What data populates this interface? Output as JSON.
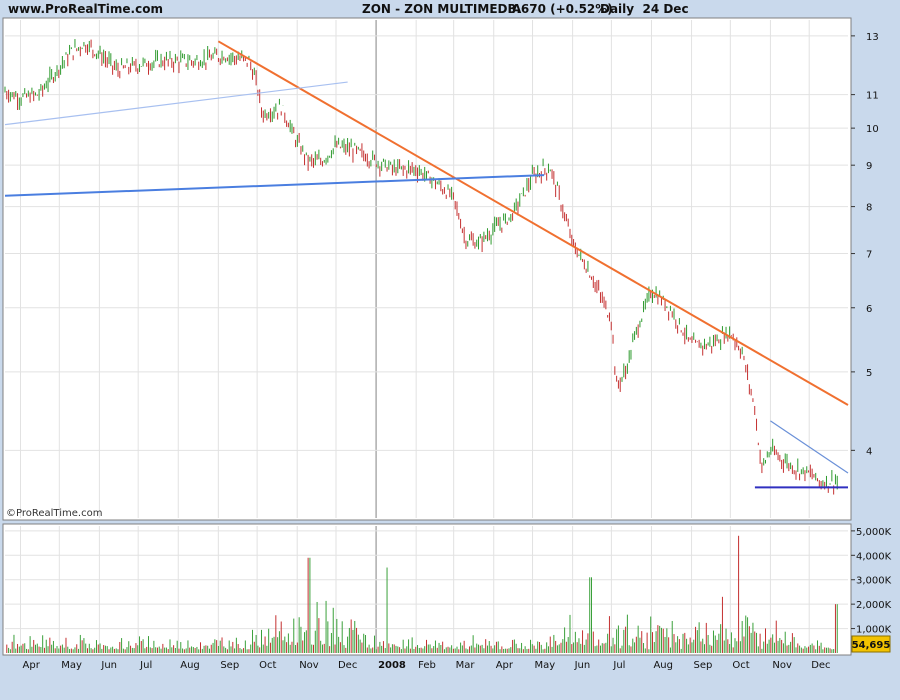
{
  "header": {
    "site": "www.ProRealTime.com",
    "title": "ZON - ZON MULTIMEDIA",
    "change": "3.670 (+0.52%)",
    "period": "Daily  24 Dec"
  },
  "watermark": "©ProRealTime.com",
  "volume_badge": "54,695",
  "chart_data": [
    {
      "type": "line",
      "title": "ZON - ZON MULTIMEDIA",
      "scale": "log",
      "ylim": [
        3.3,
        13.6
      ],
      "y_ticks": [
        4,
        5,
        6,
        7,
        8,
        9,
        10,
        11,
        13
      ],
      "x_ticks": [
        "Apr",
        "May",
        "Jun",
        "Jul",
        "Aug",
        "Sep",
        "Oct",
        "Nov",
        "Dec",
        "2008",
        "Feb",
        "Mar",
        "Apr",
        "May",
        "Jun",
        "Jul",
        "Aug",
        "Sep",
        "Oct",
        "Nov",
        "Dec"
      ],
      "grid": true,
      "last_value": 3.67,
      "change_pct": 0.52,
      "series": [
        {
          "x": [
            "2007-03-20",
            "2007-04-01",
            "2007-04-15",
            "2007-05-01",
            "2007-05-10",
            "2007-05-20",
            "2007-05-25",
            "2007-06-05",
            "2007-06-15",
            "2007-06-25",
            "2007-07-05",
            "2007-07-20",
            "2007-08-01",
            "2007-08-15",
            "2007-08-25",
            "2007-09-05",
            "2007-09-15",
            "2007-09-25",
            "2007-10-01",
            "2007-10-05",
            "2007-10-20",
            "2007-11-01",
            "2007-11-10",
            "2007-11-20",
            "2007-12-01",
            "2007-12-15",
            "2008-01-01",
            "2008-01-15",
            "2008-02-01",
            "2008-02-15",
            "2008-03-01",
            "2008-03-10",
            "2008-03-20",
            "2008-04-01",
            "2008-04-15",
            "2008-05-01",
            "2008-05-10",
            "2008-05-15",
            "2008-05-20",
            "2008-06-01",
            "2008-06-15",
            "2008-07-01",
            "2008-07-05",
            "2008-07-12",
            "2008-07-20",
            "2008-08-01",
            "2008-08-15",
            "2008-09-01",
            "2008-09-15",
            "2008-10-01",
            "2008-10-10",
            "2008-10-20",
            "2008-10-25",
            "2008-11-01",
            "2008-11-10",
            "2008-11-20",
            "2008-12-01",
            "2008-12-10",
            "2008-12-24"
          ],
          "values": [
            11.1,
            10.9,
            11.0,
            11.9,
            12.4,
            12.7,
            12.6,
            12.2,
            11.8,
            11.9,
            12.0,
            12.1,
            12.1,
            12.1,
            12.2,
            12.3,
            12.2,
            12.1,
            11.3,
            10.4,
            10.6,
            9.6,
            9.1,
            9.1,
            9.5,
            9.4,
            9.1,
            8.9,
            8.9,
            8.6,
            8.2,
            7.3,
            7.2,
            7.5,
            7.8,
            8.7,
            8.9,
            8.9,
            8.4,
            7.2,
            6.6,
            5.8,
            4.8,
            5.0,
            5.6,
            6.3,
            6.0,
            5.4,
            5.4,
            5.6,
            5.3,
            4.5,
            3.8,
            4.0,
            3.9,
            3.8,
            3.75,
            3.65,
            3.67
          ]
        }
      ],
      "trendlines": [
        {
          "name": "resistance",
          "color": "#f07030",
          "from": [
            "2007-09-01",
            12.8
          ],
          "to": [
            "2008-12-31",
            4.55
          ]
        },
        {
          "name": "long-term",
          "color": "#4a7ee0",
          "from": [
            "2007-03-20",
            8.25
          ],
          "to": [
            "2008-05-10",
            8.75
          ]
        },
        {
          "name": "upper",
          "color": "#a8c0f0",
          "from": [
            "2007-03-20",
            10.1
          ],
          "to": [
            "2007-12-10",
            11.4
          ]
        },
        {
          "name": "support",
          "color": "#3030c0",
          "from": [
            "2008-10-20",
            3.6
          ],
          "to": [
            "2008-12-31",
            3.6
          ]
        },
        {
          "name": "wedge",
          "color": "#6a90d8",
          "from": [
            "2008-11-01",
            4.35
          ],
          "to": [
            "2008-12-31",
            3.75
          ]
        }
      ]
    },
    {
      "type": "bar",
      "title": "Volume",
      "ylim": [
        0,
        5200
      ],
      "y_ticks": [
        "1,000K",
        "2,000K",
        "3,000K",
        "4,000K",
        "5,000K"
      ],
      "x_ticks": [
        "Apr",
        "May",
        "Jun",
        "Jul",
        "Aug",
        "Sep",
        "Oct",
        "Nov",
        "Dec",
        "2008",
        "Feb",
        "Mar",
        "Apr",
        "May",
        "Jun",
        "Jul",
        "Aug",
        "Sep",
        "Oct",
        "Nov",
        "Dec"
      ],
      "last_value": 54.695,
      "peaks": [
        {
          "x": "2007-11-10",
          "value": 3900
        },
        {
          "x": "2008-01-10",
          "value": 3500
        },
        {
          "x": "2008-06-15",
          "value": 3100
        },
        {
          "x": "2008-09-25",
          "value": 2300
        },
        {
          "x": "2008-10-07",
          "value": 4800
        },
        {
          "x": "2008-12-22",
          "value": 2000
        }
      ]
    }
  ]
}
